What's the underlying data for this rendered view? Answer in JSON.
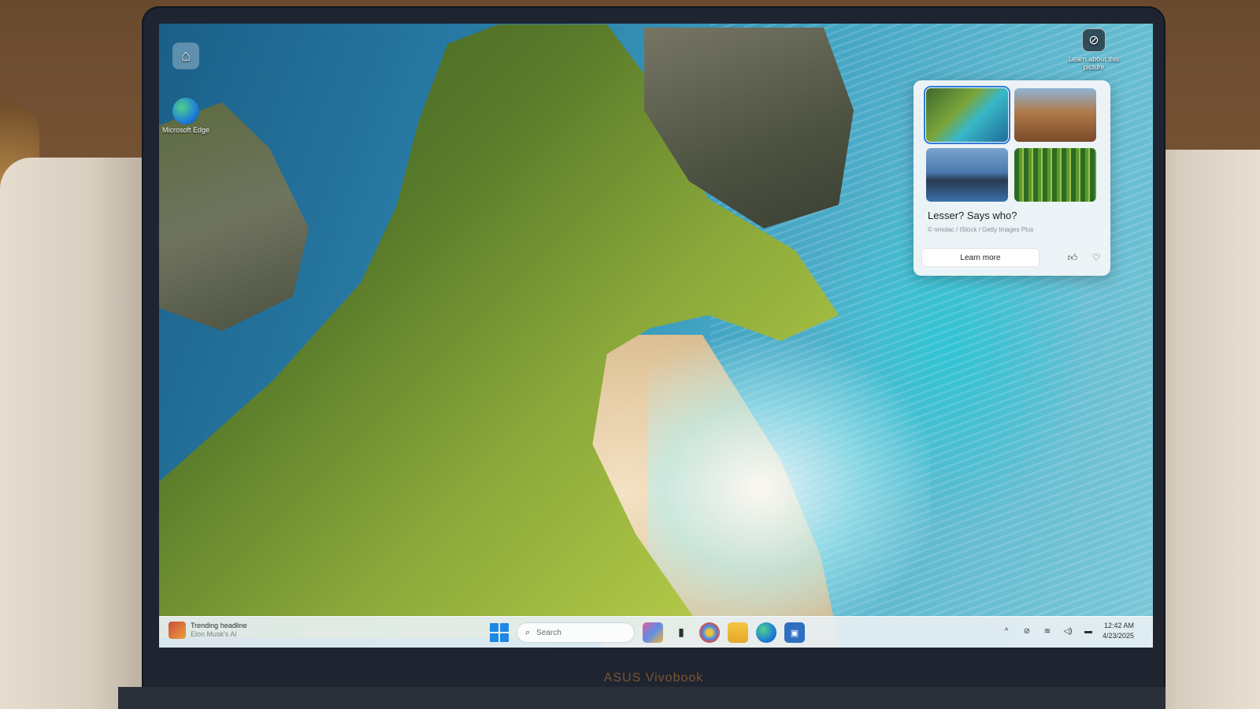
{
  "desktop": {
    "icons": [
      {
        "label": "",
        "icon": "recycle-bin-icon"
      },
      {
        "label": "Microsoft Edge",
        "icon": "edge-icon"
      }
    ],
    "learn_corner_label": "Learn about this picture"
  },
  "spotlight_card": {
    "title": "Lesser? Says who?",
    "credit": "© nmolac / iStock / Getty Images Plus",
    "learn_more": "Learn more",
    "like_icon": "thumbs-up-icon",
    "dislike_icon": "thumbs-down-icon"
  },
  "taskbar": {
    "widget_title": "Trending headline",
    "widget_subtitle": "Elon Musk's AI",
    "search_placeholder": "Search",
    "apps": [
      "copilot-icon",
      "task-view-icon",
      "edge-icon",
      "file-explorer-icon",
      "edge-icon",
      "store-icon"
    ],
    "tray": {
      "chevron": "^",
      "time": "12:42 AM",
      "date": "4/23/2025"
    }
  },
  "laptop_brand": "ASUS Vivobook",
  "colors": {
    "accent": "#1e88e5",
    "card_bg": "#f3f5f8",
    "taskbar_bg": "#e8f0f4"
  }
}
